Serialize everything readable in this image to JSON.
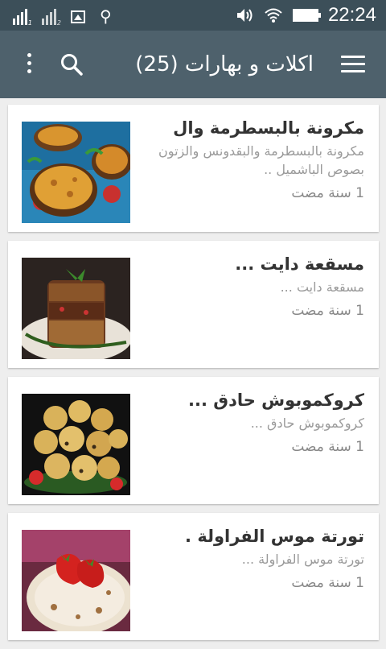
{
  "status_bar": {
    "time": "22:24",
    "icons": [
      "signal-icon",
      "signal-icon-sim2",
      "image-icon",
      "usb-icon",
      "volume-icon",
      "wifi-icon",
      "battery-icon"
    ]
  },
  "app_bar": {
    "title": "اكلات و بهارات (25)",
    "menu_icon": "hamburger-menu-icon",
    "search_icon": "search-icon",
    "more_icon": "more-vert-icon"
  },
  "recipes": [
    {
      "title": "مكرونة بالبسطرمة وال",
      "description": "مكرونة بالبسطرمة والبقدونس والزتون بصوص الباشميل ..",
      "time": "1 سنة مضت",
      "image": "pasta-dish-photo"
    },
    {
      "title": "مسقعة دايت ...",
      "description": "مسقعة دايت ...",
      "time": "1 سنة مضت",
      "image": "moussaka-photo"
    },
    {
      "title": "كروكموبوش حادق ...",
      "description": "كروكموبوش حادق ...",
      "time": "1 سنة مضت",
      "image": "croquembouche-photo"
    },
    {
      "title": "تورتة موس الفراولة .",
      "description": "تورتة موس الفراولة ...",
      "time": "1 سنة مضت",
      "image": "strawberry-cake-photo"
    }
  ]
}
